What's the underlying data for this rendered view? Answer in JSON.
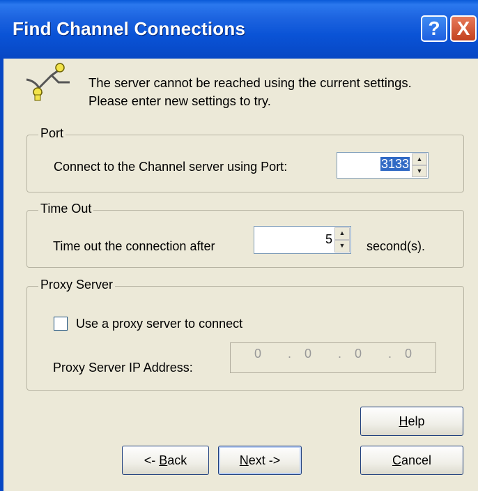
{
  "window": {
    "title": "Find Channel Connections",
    "help_button": "?",
    "close_button": "X"
  },
  "message": {
    "line1": "The server cannot be reached using the current settings.",
    "line2": "Please enter new settings to try."
  },
  "port": {
    "group_label": "Port",
    "label": "Connect to the Channel server using Port:",
    "value": "3133"
  },
  "timeout": {
    "group_label": "Time Out",
    "label": "Time out the connection after",
    "value": "5",
    "unit": "second(s)."
  },
  "proxy": {
    "group_label": "Proxy Server",
    "checkbox_label": "Use a proxy server to connect",
    "checked": false,
    "ip_label": "Proxy Server IP Address:",
    "ip_octets": [
      "0",
      "0",
      "0",
      "0"
    ],
    "ip_dots": [
      ".",
      ".",
      "."
    ]
  },
  "buttons": {
    "help_mnemonic": "H",
    "help_rest": "elp",
    "back_prefix": "<- ",
    "back_mnemonic": "B",
    "back_rest": "ack",
    "next_mnemonic": "N",
    "next_rest": "ext ->",
    "cancel_mnemonic": "C",
    "cancel_rest": "ancel"
  }
}
